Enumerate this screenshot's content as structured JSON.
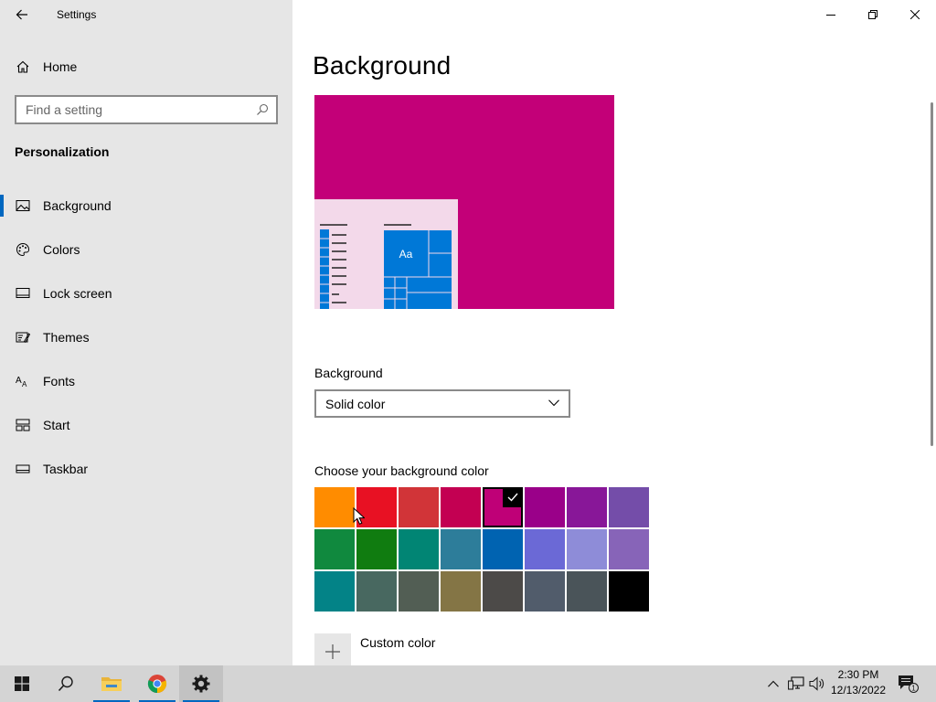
{
  "window": {
    "title": "Settings"
  },
  "sidebar": {
    "home_label": "Home",
    "search_placeholder": "Find a setting",
    "section": "Personalization",
    "items": [
      {
        "label": "Background",
        "icon": "picture-icon",
        "selected": true
      },
      {
        "label": "Colors",
        "icon": "palette-icon"
      },
      {
        "label": "Lock screen",
        "icon": "lock-screen-icon"
      },
      {
        "label": "Themes",
        "icon": "themes-icon"
      },
      {
        "label": "Fonts",
        "icon": "fonts-icon"
      },
      {
        "label": "Start",
        "icon": "start-icon"
      },
      {
        "label": "Taskbar",
        "icon": "taskbar-icon"
      }
    ]
  },
  "main": {
    "title": "Background",
    "preview_color": "#c30078",
    "preview_tile_color": "#0078d7",
    "preview_tile_text": "Aa",
    "background_label": "Background",
    "background_value": "Solid color",
    "choose_label": "Choose your background color",
    "swatches": [
      [
        "#ff8c00",
        "#e81123",
        "#d13438",
        "#c30052",
        "#bf0077",
        "#9a0089",
        "#881798",
        "#744da9"
      ],
      [
        "#10893e",
        "#107c10",
        "#018574",
        "#2d7d9a",
        "#0063b1",
        "#6b69d6",
        "#8e8cd8",
        "#8764b8"
      ],
      [
        "#038387",
        "#486860",
        "#525e54",
        "#847545",
        "#4c4a48",
        "#515c6b",
        "#4a5459",
        "#000000"
      ]
    ],
    "selected_swatch": "#bf0077",
    "custom_label": "Custom color"
  },
  "taskbar": {
    "time": "2:30 PM",
    "date": "12/13/2022",
    "notification_count": "1"
  }
}
